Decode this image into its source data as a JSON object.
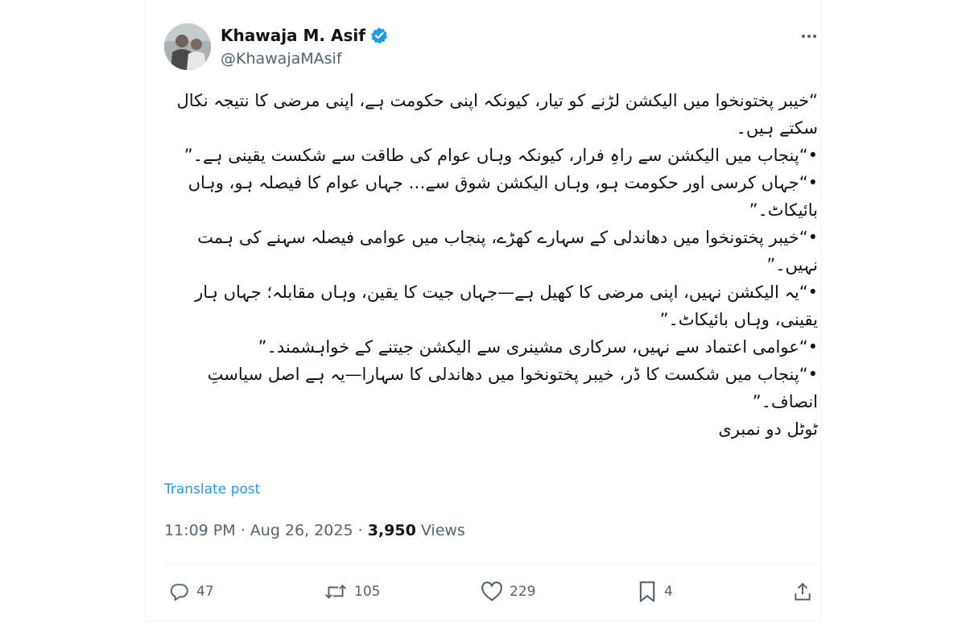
{
  "author": {
    "name": "Khawaja M. Asif",
    "handle": "@KhawajaMAsif",
    "verified": true,
    "verified_color": "#1d9bf0"
  },
  "tweet": {
    "lines": [
      "“خیبر پختونخوا میں الیکشن لڑنے کو تیار، کیونکہ اپنی حکومت ہے، اپنی مرضی کا نتیجہ نکال سکتے ہیں۔",
      "•“پنجاب میں الیکشن سے راہِ فرار، کیونکہ وہاں عوام کی طاقت سے شکست یقینی ہے۔”",
      "•“جہاں کرسی اور حکومت ہو، وہاں الیکشن شوق سے… جہاں عوام کا فیصلہ ہو، وہاں بائیکاٹ۔”",
      "•“خیبر پختونخوا میں دھاندلی کے سہارے کھڑے، پنجاب میں عوامی فیصلہ سہنے کی ہمت نہیں۔”",
      "•“یہ الیکشن نہیں، اپنی مرضی کا کھیل ہے—جہاں جیت کا یقین، وہاں مقابلہ؛ جہاں ہار یقینی، وہاں بائیکاٹ۔”",
      "•“عوامی اعتماد سے نہیں، سرکاری مشینری سے الیکشن جیتنے کے خواہشمند۔”",
      "•“پنجاب میں شکست کا ڈر، خیبر پختونخوا میں دھاندلی کا سہارا—یہ ہے اصل سیاستِ انصاف۔”",
      "ٹوٹل دو نمبری"
    ],
    "translate_label": "Translate post",
    "time": "11:09 PM",
    "date": "Aug 26, 2025",
    "views_count": "3,950",
    "views_label": "Views"
  },
  "actions": {
    "replies": "47",
    "reposts": "105",
    "likes": "229",
    "bookmarks": "4"
  },
  "icons": [
    "more-icon",
    "verified-badge-icon",
    "reply-icon",
    "repost-icon",
    "like-icon",
    "bookmark-icon",
    "share-icon"
  ],
  "colors": {
    "text": "#0f1419",
    "secondary": "#536471",
    "link": "#1d9bf0",
    "border": "#eff3f4"
  }
}
